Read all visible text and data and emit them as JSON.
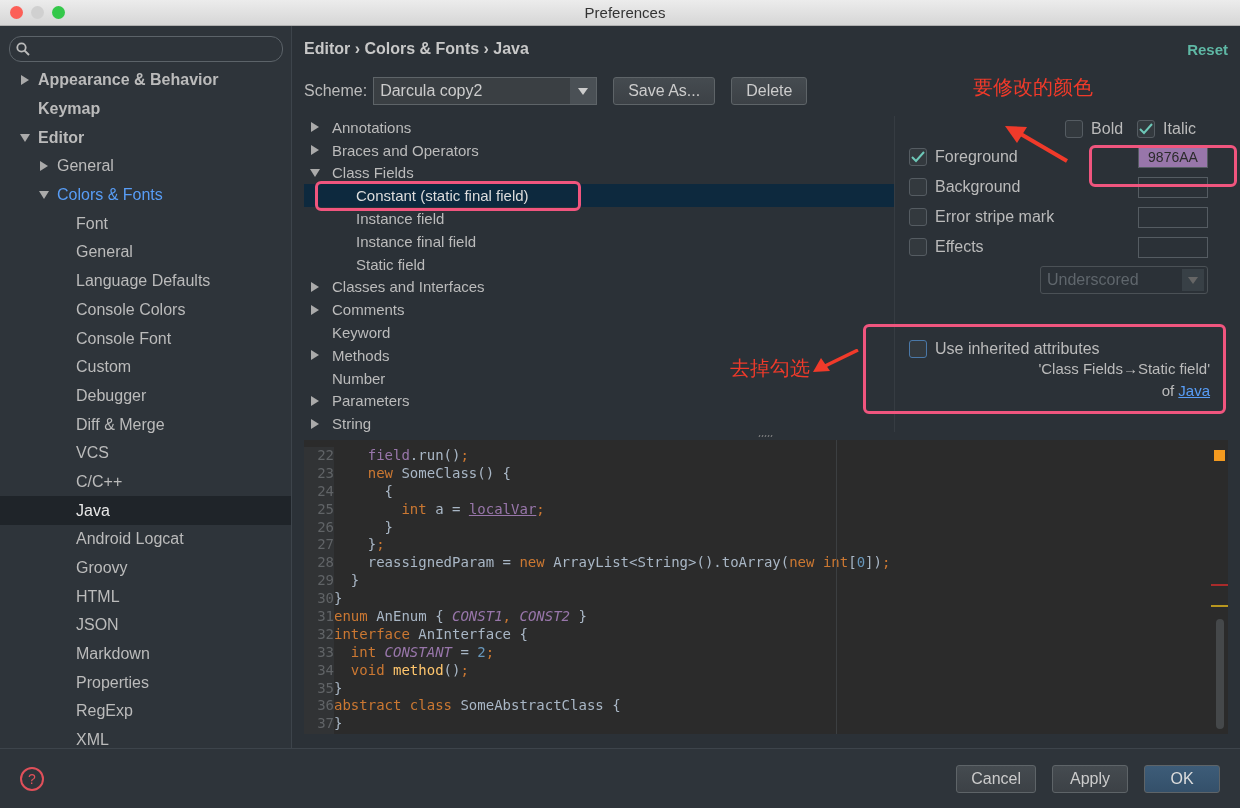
{
  "window": {
    "title": "Preferences"
  },
  "sidebar": {
    "items": [
      {
        "label": "Appearance & Behavior",
        "expanded": false,
        "selected": false
      },
      {
        "label": "Keymap",
        "selected": false
      },
      {
        "label": "Editor",
        "expanded": true,
        "selected": false,
        "children": [
          {
            "label": "General",
            "expanded": false,
            "selected": false
          },
          {
            "label": "Colors & Fonts",
            "expanded": true,
            "selected": false,
            "modified": true,
            "children": [
              {
                "label": "Font",
                "selected": false
              },
              {
                "label": "General",
                "selected": false
              },
              {
                "label": "Language Defaults",
                "selected": false
              },
              {
                "label": "Console Colors",
                "selected": false
              },
              {
                "label": "Console Font",
                "selected": false
              },
              {
                "label": "Custom",
                "selected": false
              },
              {
                "label": "Debugger",
                "selected": false
              },
              {
                "label": "Diff & Merge",
                "selected": false
              },
              {
                "label": "VCS",
                "selected": false
              },
              {
                "label": "C/C++",
                "selected": false
              },
              {
                "label": "Java",
                "selected": true
              },
              {
                "label": "Android Logcat",
                "selected": false
              },
              {
                "label": "Groovy",
                "selected": false
              },
              {
                "label": "HTML",
                "selected": false
              },
              {
                "label": "JSON",
                "selected": false
              },
              {
                "label": "Markdown",
                "selected": false
              },
              {
                "label": "Properties",
                "selected": false
              },
              {
                "label": "RegExp",
                "selected": false
              },
              {
                "label": "XML",
                "selected": false
              }
            ]
          }
        ]
      }
    ]
  },
  "header": {
    "breadcrumb": "Editor › Colors & Fonts › Java",
    "reset": "Reset"
  },
  "scheme": {
    "label": "Scheme:",
    "value": "Darcula copy2",
    "buttons": [
      "Save As...",
      "Delete"
    ]
  },
  "attributes": [
    {
      "label": "Annotations",
      "expanded": false,
      "selected": false
    },
    {
      "label": "Braces and Operators",
      "expanded": false,
      "selected": false
    },
    {
      "label": "Class Fields",
      "expanded": true,
      "selected": false,
      "children": [
        {
          "label": "Constant (static final field)",
          "selected": true
        },
        {
          "label": "Instance field",
          "selected": false
        },
        {
          "label": "Instance final field",
          "selected": false
        },
        {
          "label": "Static field",
          "selected": false
        }
      ]
    },
    {
      "label": "Classes and Interfaces",
      "expanded": false,
      "selected": false
    },
    {
      "label": "Comments",
      "expanded": false,
      "selected": false
    },
    {
      "label": "Keyword",
      "selected": false
    },
    {
      "label": "Methods",
      "expanded": false,
      "selected": false
    },
    {
      "label": "Number",
      "selected": false
    },
    {
      "label": "Parameters",
      "expanded": false,
      "selected": false
    },
    {
      "label": "String",
      "expanded": false,
      "selected": false
    }
  ],
  "font_style": [
    {
      "label": "Bold",
      "checked": false
    },
    {
      "label": "Italic",
      "checked": true
    }
  ],
  "color_options": [
    {
      "label": "Foreground",
      "checked": true,
      "value": "9876AA",
      "color": "#9876aa"
    },
    {
      "label": "Background",
      "checked": false
    },
    {
      "label": "Error stripe mark",
      "checked": false
    },
    {
      "label": "Effects",
      "checked": false
    }
  ],
  "effects_dropdown": {
    "value": "Underscored",
    "disabled": true
  },
  "inherited": {
    "label": "Use inherited attributes",
    "checked": false,
    "source": "'Class Fields→Static field'",
    "of": "of",
    "link": "Java"
  },
  "code": [
    {
      "n": "22",
      "tokens": [
        {
          "text": "    field",
          "kind": "f"
        },
        {
          "text": ".run()",
          "kind": "p"
        },
        {
          "text": ";",
          "kind": "k"
        }
      ]
    },
    {
      "n": "23",
      "tokens": [
        {
          "text": "    new",
          "kind": "k"
        },
        {
          "text": " SomeClass() {",
          "kind": "p"
        }
      ]
    },
    {
      "n": "24",
      "tokens": [
        {
          "text": "      {",
          "kind": "p"
        }
      ]
    },
    {
      "n": "25",
      "tokens": [
        {
          "text": "        int",
          "kind": "k"
        },
        {
          "text": " a = ",
          "kind": "p"
        },
        {
          "text": "localVar",
          "kind": "u"
        },
        {
          "text": ";",
          "kind": "k"
        }
      ]
    },
    {
      "n": "26",
      "tokens": [
        {
          "text": "      }",
          "kind": "p"
        }
      ]
    },
    {
      "n": "27",
      "tokens": [
        {
          "text": "    }",
          "kind": "p"
        },
        {
          "text": ";",
          "kind": "k"
        }
      ]
    },
    {
      "n": "28",
      "tokens": [
        {
          "text": "    reassignedParam = ",
          "kind": "p"
        },
        {
          "text": "new",
          "kind": "k"
        },
        {
          "text": " ArrayList<String>().toArray(",
          "kind": "p"
        },
        {
          "text": "new int",
          "kind": "k"
        },
        {
          "text": "[",
          "kind": "p"
        },
        {
          "text": "0",
          "kind": "n"
        },
        {
          "text": "])",
          "kind": "p"
        },
        {
          "text": ";",
          "kind": "k"
        }
      ]
    },
    {
      "n": "29",
      "tokens": [
        {
          "text": "  }",
          "kind": "p"
        }
      ]
    },
    {
      "n": "30",
      "tokens": [
        {
          "text": "}",
          "kind": "p"
        }
      ]
    },
    {
      "n": "31",
      "tokens": [
        {
          "text": "enum",
          "kind": "k"
        },
        {
          "text": " AnEnum { ",
          "kind": "p"
        },
        {
          "text": "CONST1",
          "kind": "c"
        },
        {
          "text": ", ",
          "kind": "k"
        },
        {
          "text": "CONST2",
          "kind": "c"
        },
        {
          "text": " }",
          "kind": "p"
        }
      ]
    },
    {
      "n": "32",
      "tokens": [
        {
          "text": "interface",
          "kind": "k"
        },
        {
          "text": " AnInterface {",
          "kind": "p"
        }
      ]
    },
    {
      "n": "33",
      "tokens": [
        {
          "text": "  int ",
          "kind": "k"
        },
        {
          "text": "CONSTANT",
          "kind": "c"
        },
        {
          "text": " = ",
          "kind": "p"
        },
        {
          "text": "2",
          "kind": "n"
        },
        {
          "text": ";",
          "kind": "k"
        }
      ]
    },
    {
      "n": "34",
      "tokens": [
        {
          "text": "  void ",
          "kind": "k"
        },
        {
          "text": "method",
          "kind": "m"
        },
        {
          "text": "()",
          "kind": "p"
        },
        {
          "text": ";",
          "kind": "k"
        }
      ]
    },
    {
      "n": "35",
      "tokens": [
        {
          "text": "}",
          "kind": "p"
        }
      ]
    },
    {
      "n": "36",
      "tokens": [
        {
          "text": "abstract class",
          "kind": "k"
        },
        {
          "text": " SomeAbstractClass {",
          "kind": "p"
        }
      ]
    },
    {
      "n": "37",
      "tokens": [
        {
          "text": "}",
          "kind": "p"
        }
      ]
    }
  ],
  "footer": {
    "buttons": [
      {
        "label": "Cancel",
        "default": false
      },
      {
        "label": "Apply",
        "default": false
      },
      {
        "label": "OK",
        "default": true
      }
    ],
    "help": "?"
  },
  "annotations": [
    {
      "text": "要修改的颜色"
    },
    {
      "text": "去掉勾选"
    }
  ]
}
